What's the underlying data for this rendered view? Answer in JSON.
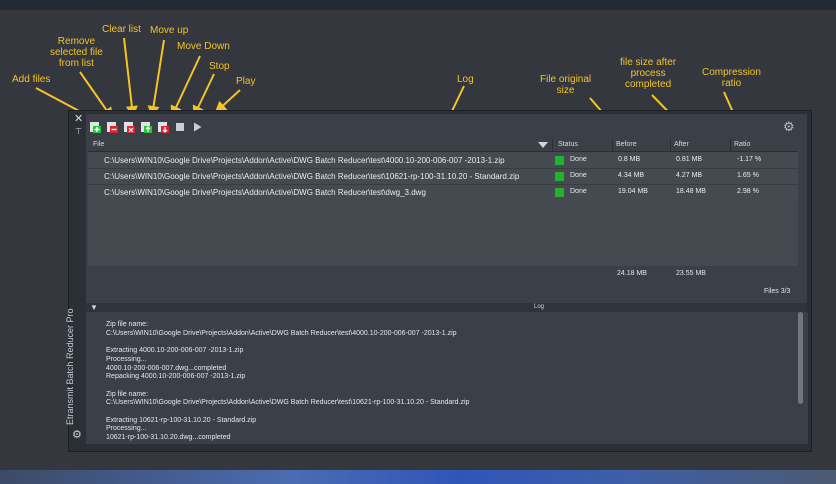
{
  "annotations": {
    "add_files": "Add files",
    "remove_selected": [
      "Remove",
      "selected file",
      "from list"
    ],
    "clear_list": "Clear list",
    "move_up": "Move up",
    "move_down": "Move Down",
    "stop": "Stop",
    "play": "Play",
    "log": "Log",
    "file_original_size": [
      "File original",
      "size"
    ],
    "file_size_after": [
      "file size after",
      "process",
      "completed"
    ],
    "compression_ratio": [
      "Compression",
      "ratio"
    ]
  },
  "palette": {
    "side_title": "Etransmit Batch Reducer Pro",
    "close_glyph": "✕"
  },
  "toolbar": {
    "icons": [
      "add-files-icon",
      "remove-file-icon",
      "clear-list-icon",
      "move-up-icon",
      "move-down-icon",
      "stop-icon",
      "play-icon"
    ]
  },
  "grid": {
    "columns": [
      "File",
      "Status",
      "Before",
      "After",
      "Ratio"
    ],
    "rows": [
      {
        "file": "C:\\Users\\WIN10\\Google Drive\\Projects\\Addon\\Active\\DWG Batch Reducer\\test\\4000.10-200-006-007 -2013-1.zip",
        "status": "Done",
        "before": "0.8 MB",
        "after": "0.81 MB",
        "ratio": "-1.17 %"
      },
      {
        "file": "C:\\Users\\WIN10\\Google Drive\\Projects\\Addon\\Active\\DWG Batch Reducer\\test\\10621-rp-100-31.10.20 - Standard.zip",
        "status": "Done",
        "before": "4.34 MB",
        "after": "4.27 MB",
        "ratio": "1.65 %"
      },
      {
        "file": "C:\\Users\\WIN10\\Google Drive\\Projects\\Addon\\Active\\DWG Batch Reducer\\test\\dwg_3.dwg",
        "status": "Done",
        "before": "19.04 MB",
        "after": "18.48 MB",
        "ratio": "2.98 %"
      }
    ],
    "status_color": "#1fb42c",
    "total_before": "24.18 MB",
    "total_after": "23.55 MB",
    "files_count": "Files 3/3"
  },
  "log": {
    "title": "Log",
    "lines": [
      "Zip file name:",
      "C:\\Users\\WIN10\\Google Drive\\Projects\\Addon\\Active\\DWG Batch Reducer\\test\\4000.10-200-006-007 -2013-1.zip",
      "",
      "Extracting 4000.10-200-006-007 -2013-1.zip",
      "Processing...",
      "4000.10-200-006-007.dwg...completed",
      "Repacking 4000.10-200-006-007 -2013-1.zip",
      "",
      "Zip file name:",
      "C:\\Users\\WIN10\\Google Drive\\Projects\\Addon\\Active\\DWG Batch Reducer\\test\\10621-rp-100-31.10.20 - Standard.zip",
      "",
      "Extracting 10621-rp-100-31.10.20 - Standard.zip",
      "Processing...",
      "10621-rp-100-31.10.20.dwg...completed"
    ]
  },
  "colors": {
    "annotation": "#f5c327",
    "panel": "#3a3f48"
  }
}
